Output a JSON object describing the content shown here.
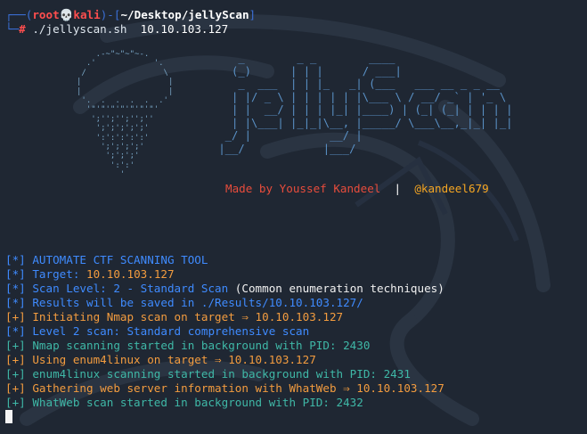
{
  "prompt": {
    "box_top_left": "┌──(",
    "user": "root",
    "skull": "💀",
    "host": "kali",
    "box_mid": ")-[",
    "path": "~/Desktop/jellyScan",
    "box_end": "]",
    "box_bottom_left": "└─",
    "hash": "#",
    "command": " ./jellyscan.sh",
    "argument": "  10.10.103.127"
  },
  "banner": {
    "ascii_logo": "    .-~\"~\"~\"~-.\n  .'            '.\n /                \\\n|                  |\n|                  |\n '.  .  .  .  .  .'\n  '\"'\"'\"'\"'\"'\"'\"'\n   ';'';'';'';''\n    ';';';';';'\n    ':':':':':'\n     ';';';';'\n      ';';';'\n       ':':'\n         '",
    "ascii_title": "    _        _ _        ____\n   (_)      | | |      / ___|\n    _  ___  | | |_   _| (___   ___ __ _ _ __\n   | |/ _ \\ | | | | | |\\___ \\ / __/ _` | '_ \\\n   | |  __/ | | | |_| |____) | (_| (_| | | | |\n   | |\\___| |_|_|\\__, |_____/ \\___\\__,_|_| |_|\n  _/ |            __/ |\n |__/            |___/",
    "credit_by": "Made by Youssef Kandeel",
    "credit_sep": "  |  ",
    "credit_handle": "@kandeel679"
  },
  "output": {
    "l1": "[*] AUTOMATE CTF SCANNING TOOL",
    "l2_prefix": "[*] Target: ",
    "l2_value": "10.10.103.127",
    "l3_prefix": "[*] Scan Level: 2 - Standard Scan ",
    "l3_note": "(Common enumeration techniques)",
    "l4": "[*] Results will be saved in ./Results/10.10.103.127/",
    "l5": "[+] Initiating Nmap scan on target ⇒ 10.10.103.127",
    "l6": "[*] Level 2 scan: Standard comprehensive scan",
    "l7": "[+] Nmap scanning started in background with PID: 2430",
    "l8": "[+] Using enum4linux on target ⇒ 10.10.103.127",
    "l9": "[+] enum4linux scanning started in background with PID: 2431",
    "l10": "[+] Gathering web server information with WhatWeb ⇒ 10.10.103.127",
    "l11": "[+] WhatWeb scan started in background with PID: 2432"
  },
  "colors": {
    "background": "#1f2733",
    "prompt_box": "#3b6fd6",
    "root_red": "#ff4e4e",
    "info_blue": "#3f8bff",
    "action_orange": "#f39c3f",
    "status_teal": "#3fb8a7"
  }
}
